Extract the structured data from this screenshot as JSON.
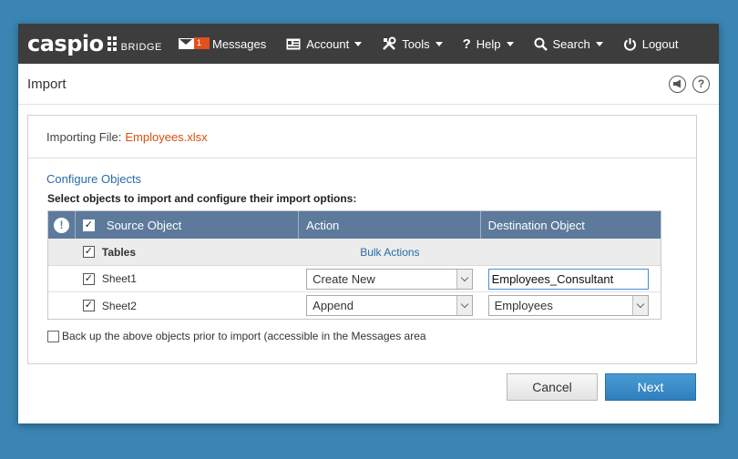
{
  "app": {
    "logo_word": "caspio",
    "logo_sub": "BRIDGE"
  },
  "nav": {
    "messages_label": "Messages",
    "messages_count": "1",
    "account_label": "Account",
    "tools_label": "Tools",
    "help_label": "Help",
    "search_label": "Search",
    "logout_label": "Logout"
  },
  "page": {
    "title": "Import"
  },
  "import": {
    "file_label": "Importing File:",
    "file_name": "Employees.xlsx",
    "configure_link": "Configure Objects",
    "instructions": "Select objects to import and configure their import options:",
    "columns": {
      "source": "Source Object",
      "action": "Action",
      "destination": "Destination Object"
    },
    "group": {
      "label": "Tables",
      "bulk_actions": "Bulk Actions"
    },
    "rows": [
      {
        "source": "Sheet1",
        "action": "Create New",
        "destination": "Employees_Consultant",
        "checked": true
      },
      {
        "source": "Sheet2",
        "action": "Append",
        "destination": "Employees",
        "checked": true
      }
    ],
    "backup_label": "Back up the above objects prior to import (accessible in the Messages area"
  },
  "buttons": {
    "cancel": "Cancel",
    "next": "Next"
  },
  "colors": {
    "background": "#3a85b3",
    "topnav": "#3d3d3d",
    "grid_header": "#5d7a9c",
    "accent_orange": "#d94f10",
    "link_blue": "#2a6ba8",
    "next_button": "#3a8cc9"
  }
}
